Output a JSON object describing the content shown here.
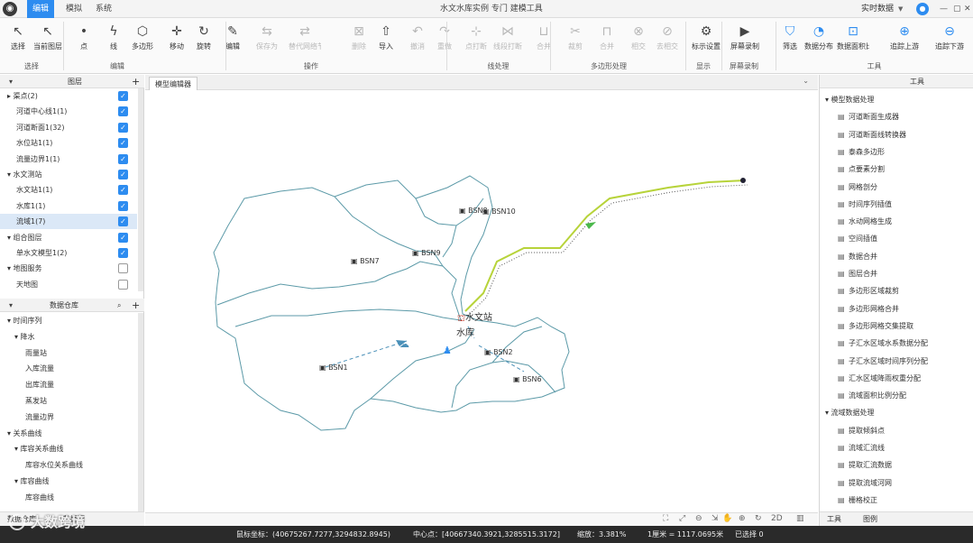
{
  "title_bar": {
    "logo": "app-logo-icon",
    "menus": [
      "编辑",
      "模拟",
      "系统"
    ],
    "window_title": "水文水库实例 专门 建模工具",
    "user": "实时数据",
    "avatar": "user-icon"
  },
  "ribbon": {
    "tools": [
      {
        "label": "选择",
        "icon": "↖"
      },
      {
        "label": "当前图层",
        "icon": "↖"
      },
      {
        "label": "点",
        "icon": "•"
      },
      {
        "label": "线",
        "icon": "ϟ"
      },
      {
        "label": "多边形",
        "icon": "⬡"
      },
      {
        "label": "移动",
        "icon": "✛"
      },
      {
        "label": "旋转",
        "icon": "↻"
      },
      {
        "label": "编辑",
        "icon": "✎"
      },
      {
        "label": "保存为",
        "icon": "⇆"
      },
      {
        "label": "替代网络节点",
        "icon": "⇄"
      },
      {
        "label": "删除",
        "icon": "⊠"
      },
      {
        "label": "导入",
        "icon": "⇧"
      },
      {
        "label": "撤消",
        "icon": "↶"
      },
      {
        "label": "重做",
        "icon": "↷"
      },
      {
        "label": "点打断",
        "icon": "⊹"
      },
      {
        "label": "线段打断",
        "icon": "⋈"
      },
      {
        "label": "合并",
        "icon": "⊔"
      },
      {
        "label": "裁剪",
        "icon": "✂"
      },
      {
        "label": "合并",
        "icon": "⊓"
      },
      {
        "label": "相交",
        "icon": "⊗"
      },
      {
        "label": "去相交",
        "icon": "⊘"
      },
      {
        "label": "标示设置",
        "icon": "⚙"
      },
      {
        "label": "屏幕录制",
        "icon": "▶"
      },
      {
        "label": "筛选",
        "icon": "⛉"
      },
      {
        "label": "数据分布",
        "icon": "◔"
      },
      {
        "label": "数据面积比",
        "icon": "⊡"
      },
      {
        "label": "追踪上游",
        "icon": "⊕"
      },
      {
        "label": "追踪下游",
        "icon": "⊖"
      }
    ],
    "groups": [
      "选择",
      "编辑",
      "操作",
      "线处理",
      "多边形处理",
      "显示",
      "屏幕录制",
      "工具"
    ]
  },
  "layers_panel": {
    "title": "图层",
    "rows": [
      {
        "label": "▸ 渠点(2)",
        "checked": true
      },
      {
        "label": "河道中心线1(1)",
        "checked": true
      },
      {
        "label": "河道断面1(32)",
        "checked": true
      },
      {
        "label": "水位站1(1)",
        "checked": true
      },
      {
        "label": "流量边界1(1)",
        "checked": true
      },
      {
        "label": "▾ 水文测站",
        "checked": true
      },
      {
        "label": "水文站1(1)",
        "checked": true
      },
      {
        "label": "水库1(1)",
        "checked": true
      },
      {
        "label": "流域1(7)",
        "checked": true
      },
      {
        "label": "▾ 组合图层",
        "checked": true
      },
      {
        "label": "单水文模型1(2)",
        "checked": true
      },
      {
        "label": "▾ 地图服务",
        "checked": false
      },
      {
        "label": "天地图",
        "checked": false
      }
    ]
  },
  "data_panel": {
    "title": "数据仓库",
    "rows": [
      "▾ 时间序列",
      "▾ 降水",
      "雨量站",
      "入库流量",
      "出库流量",
      "蒸发站",
      "流量边界",
      "▾ 关系曲线",
      "▾ 库容关系曲线",
      "库容水位关系曲线",
      "▾ 库容曲线",
      "库容曲线"
    ],
    "bottom_tabs": [
      "数据仓库",
      "数据源"
    ]
  },
  "map": {
    "tab": "模型编辑器",
    "labels": [
      "BSN1",
      "BSN7",
      "BSN9",
      "BSN10",
      "BSN2",
      "BSN8",
      "BSN6",
      "水文站",
      "水库"
    ]
  },
  "map_toolbar": [
    "⛶",
    "⤢",
    "⊖",
    "⇲",
    "✋",
    "⊕",
    "↻",
    "2D",
    "▥"
  ],
  "tools_panel": {
    "title": "工具",
    "sections": [
      {
        "title": "▾ 模型数据处理",
        "items": [
          "河道断面生成器",
          "河道断面线转换器",
          "泰森多边形",
          "点要素分割",
          "网格剖分",
          "时间序列插值",
          "水动网格生成",
          "空间插值",
          "数据合并",
          "图层合并",
          "多边形区域裁剪",
          "多边形网格合并",
          "多边形网格交集提取",
          "子汇水区域水系数据分配",
          "子汇水区域时间序列分配",
          "汇水区域降雨权重分配",
          "流域面积比例分配"
        ]
      },
      {
        "title": "▾ 流域数据处理",
        "items": [
          "提取倾斜点",
          "流域汇流线",
          "提取汇流数据",
          "提取流域河网",
          "栅格校正"
        ]
      }
    ],
    "bottom_tabs": [
      "工具",
      "图例"
    ]
  },
  "status_bar": {
    "coords": "鼠标坐标：(40675267.7277,3294832.8945)",
    "center": "中心点：[40667340.3921,3285515.3172]",
    "scale": "缩放：3.381%",
    "scale_text": "1厘米 = 1117.0695米",
    "selected": "已选择 0"
  },
  "watermark": "大数跨境"
}
